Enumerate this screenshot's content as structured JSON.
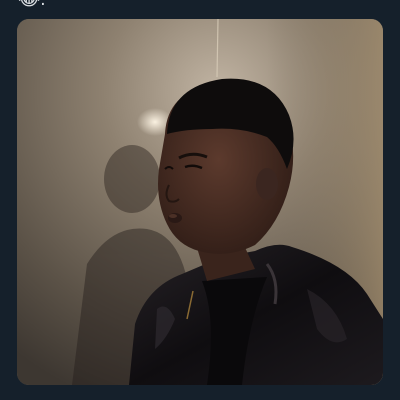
{
  "tweet": {
    "text": "😂."
  },
  "media": {
    "kind": "photo",
    "colors": {
      "background": "#15202b",
      "text": "#d9dde1",
      "wall": "#8b7f6f",
      "jacket": "#141216",
      "skin": "#4b3026",
      "hair": "#0e0c0c"
    }
  }
}
